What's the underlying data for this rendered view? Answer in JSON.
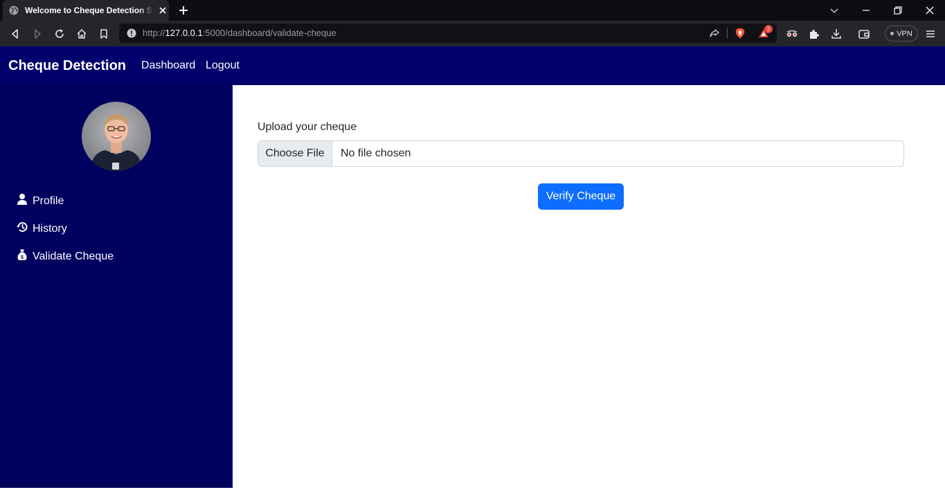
{
  "browser": {
    "tab_title": "Welcome to Cheque Detection System",
    "url_prefix": "http://",
    "url_host": "127.0.0.1",
    "url_rest": ":5000/dashboard/validate-cheque",
    "shields_badge": "2",
    "vpn_label": "VPN"
  },
  "navbar": {
    "brand": "Cheque Detection",
    "links": [
      "Dashboard",
      "Logout"
    ]
  },
  "sidebar": {
    "items": [
      {
        "label": "Profile",
        "icon": "person-icon"
      },
      {
        "label": "History",
        "icon": "history-icon"
      },
      {
        "label": "Validate Cheque",
        "icon": "money-bag-icon"
      }
    ]
  },
  "main": {
    "upload_label": "Upload your cheque",
    "choose_file_label": "Choose File",
    "file_status": "No file chosen",
    "verify_button": "Verify Cheque"
  },
  "colors": {
    "navbar_bg": "#00006b",
    "sidebar_bg": "#00005e",
    "primary_button": "#0d6efd"
  }
}
